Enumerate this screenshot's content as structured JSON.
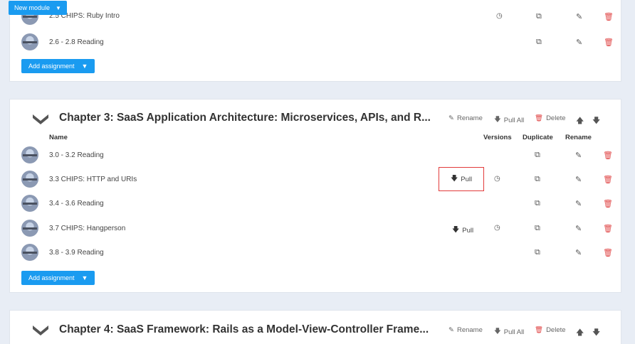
{
  "top_button": {
    "label": "New module"
  },
  "module1": {
    "partial_row": "2.5 CHIPS: Ruby Intro",
    "rows": [
      {
        "name": "2.6 - 2.8 Reading"
      }
    ],
    "add_label": "Add assignment"
  },
  "module2": {
    "title": "Chapter 3: SaaS Application Architecture: Microservices, APIs, and R...",
    "actions": {
      "rename": "Rename",
      "pull_all": "Pull All",
      "delete": "Delete"
    },
    "columns": {
      "name": "Name",
      "versions": "Versions",
      "duplicate": "Duplicate",
      "rename": "Rename"
    },
    "rows": [
      {
        "name": "3.0 - 3.2 Reading"
      },
      {
        "name": "3.3 CHIPS: HTTP and URIs",
        "pull": "Pull"
      },
      {
        "name": "3.4 - 3.6 Reading"
      },
      {
        "name": "3.7 CHIPS: Hangperson",
        "pull": "Pull"
      },
      {
        "name": "3.8 - 3.9 Reading"
      }
    ],
    "add_label": "Add assignment"
  },
  "module3": {
    "title": "Chapter 4: SaaS Framework: Rails as a Model-View-Controller Frame...",
    "actions": {
      "rename": "Rename",
      "pull_all": "Pull All",
      "delete": "Delete"
    }
  },
  "colors": {
    "accent": "#1a9bf0",
    "danger": "#e04848",
    "highlight": "#e23b3b"
  }
}
